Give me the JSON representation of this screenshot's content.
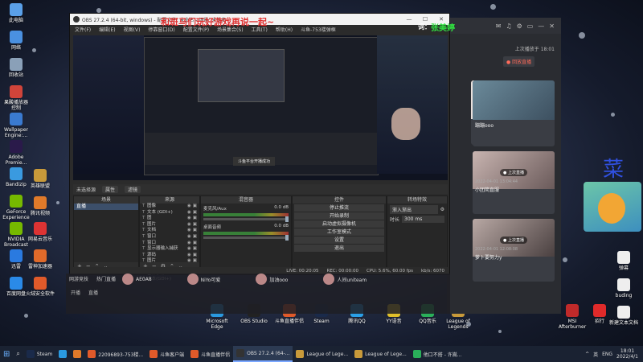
{
  "desktop_left": [
    {
      "label": "此电脑",
      "color": "#5aa0e8"
    },
    {
      "label": "网络",
      "color": "#4a90e0"
    },
    {
      "label": "回收站",
      "color": "#8aa0b8"
    },
    {
      "label": "果酸播放器\n控制",
      "color": "#d0443a"
    },
    {
      "label": "Wallpaper\nEngine:...",
      "color": "#3a7ad0"
    },
    {
      "label": "Adobe\nPremie...",
      "color": "#2a1a4a"
    },
    {
      "label": "Bandizip",
      "color": "#3a9ae0"
    },
    {
      "label": "GeForce\nExperience",
      "color": "#76b900"
    },
    {
      "label": "NVIDIA\nBroadcast",
      "color": "#76b900"
    },
    {
      "label": "迅雷",
      "color": "#2a7ae0"
    },
    {
      "label": "百度网盘",
      "color": "#2a8ae8"
    }
  ],
  "desktop_col2": [
    {
      "label": "英雄联盟",
      "color": "#c89a3a"
    },
    {
      "label": "腾讯视频",
      "color": "#e07a2a"
    },
    {
      "label": "网易云音乐",
      "color": "#d33"
    },
    {
      "label": "雷神加速器",
      "color": "#e06a2a"
    },
    {
      "label": "火绒安全软件",
      "color": "#e05a2a"
    }
  ],
  "desktop_right": [
    {
      "label": "弹幕",
      "color": "#eee"
    },
    {
      "label": "buding",
      "color": "#eee"
    },
    {
      "label": "新建文本文档",
      "color": "#eee"
    }
  ],
  "desktop_bottom": [
    {
      "label": "Microsoft\nEdge",
      "color": "#2a9ae0"
    },
    {
      "label": "OBS Studio",
      "color": "#222"
    },
    {
      "label": "斗鱼直播伴侣",
      "color": "#e05a2a"
    },
    {
      "label": "Steam",
      "color": "#1a2a4a"
    },
    {
      "label": "腾讯QQ",
      "color": "#2aa0e8"
    },
    {
      "label": "YY语音",
      "color": "#e0c02a"
    },
    {
      "label": "QQ音乐",
      "color": "#2ab05a"
    },
    {
      "label": "League of\nLegends",
      "color": "#c89a3a"
    },
    {
      "label": "MSI\nAfterburner",
      "color": "#c02a2a"
    },
    {
      "label": "招行",
      "color": "#e02a2a"
    }
  ],
  "obs": {
    "title": "OBS 27.2.4 (64-bit, windows) - 配置文件: 未命名 - 场景: 未命名",
    "menu": [
      "文件(F)",
      "编辑(E)",
      "视图(V)",
      "停靠窗口(D)",
      "配置文件(P)",
      "场景集合(S)",
      "工具(T)",
      "帮助(H)",
      "斗鱼-753楼弹框"
    ],
    "context_bar": {
      "label": "未选择源",
      "props": "属性",
      "filters": "滤镜"
    },
    "scenes_header": "场景",
    "scenes": [
      "直播"
    ],
    "sources_header": "来源",
    "sources": [
      "图像",
      "文本 (GDI+)",
      "图",
      "图片",
      "文档",
      "窗口",
      "窗口",
      "显示器输入捕获",
      "源码",
      "图片",
      "显示器捕获",
      "窗体字幕",
      "文本(GDI+)"
    ],
    "mixer_header": "混音器",
    "mixer": [
      {
        "name": "麦克风/Aux",
        "db": "0.0 dB"
      },
      {
        "name": "桌面音频",
        "db": "0.0 dB"
      }
    ],
    "transitions_header": "转场特效",
    "transition_select": "渐入渐出",
    "transition_duration_label": "时长",
    "transition_duration": "300 ms",
    "controls_header": "控件",
    "controls": [
      "停止推流",
      "开始录制",
      "启动虚拟摄像机",
      "工作室模式",
      "设置",
      "退出"
    ],
    "status": [
      "LIVE: 00:20:05",
      "REC: 00:00:00",
      "CPU: 5.6%, 60.00 fps",
      "kb/s: 6070"
    ],
    "preview_toast": "斗鱼平台开播成功"
  },
  "overlay": {
    "red_text": "和斑马们玩好游戏再说一起~",
    "green_text": "张美婷",
    "green_prefix": "词：",
    "blue_text": "菜"
  },
  "side_app": {
    "title_icons": [
      "✉",
      "♫",
      "⚙",
      "▭",
      "—",
      "✕"
    ],
    "record_text": "上次播放于 18:01",
    "record_badge": "● 回放直播",
    "cards": [
      {
        "caption": "",
        "time": ""
      },
      {
        "caption": "蹦蹦ooo",
        "time": ""
      },
      {
        "caption": "● 上次直播",
        "time": "2022-04-01 13:04:44"
      },
      {
        "caption": "小团简直服",
        "time": ""
      },
      {
        "caption": "● 上次直播",
        "time": "2022-04-01 12:08:08"
      },
      {
        "caption": "萝卜要努力y",
        "time": ""
      }
    ]
  },
  "chat": {
    "tabs": [
      "网游竞技",
      "热门直播"
    ],
    "actions": [
      "开播",
      "直播"
    ],
    "avatars": [
      "AE0A8",
      "NiYo可爱",
      "加油ooo",
      "人间uniteam"
    ]
  },
  "taskbar": {
    "items": [
      {
        "label": "Steam",
        "color": "#1a2a4a",
        "active": false
      },
      {
        "label": "",
        "color": "#2a9ae0",
        "active": false
      },
      {
        "label": "",
        "color": "#e07a2a",
        "active": false
      },
      {
        "label": "22096893-753楼...",
        "color": "#e05a2a",
        "active": false
      },
      {
        "label": "斗鱼客户端",
        "color": "#e05a2a",
        "active": false
      },
      {
        "label": "斗鱼直播伴侣",
        "color": "#e05a2a",
        "active": false
      },
      {
        "label": "OBS 27.2.4 (64-...",
        "color": "#333",
        "active": true
      },
      {
        "label": "League of Lege...",
        "color": "#c89a3a",
        "active": false
      },
      {
        "label": "League of Lege...",
        "color": "#c89a3a",
        "active": false
      },
      {
        "label": "他口不搭 - 许嵩...",
        "color": "#2ab05a",
        "active": false
      }
    ],
    "tray": [
      "^",
      "英",
      "ENG"
    ],
    "time": "18:01",
    "date": "2022/4/1"
  }
}
